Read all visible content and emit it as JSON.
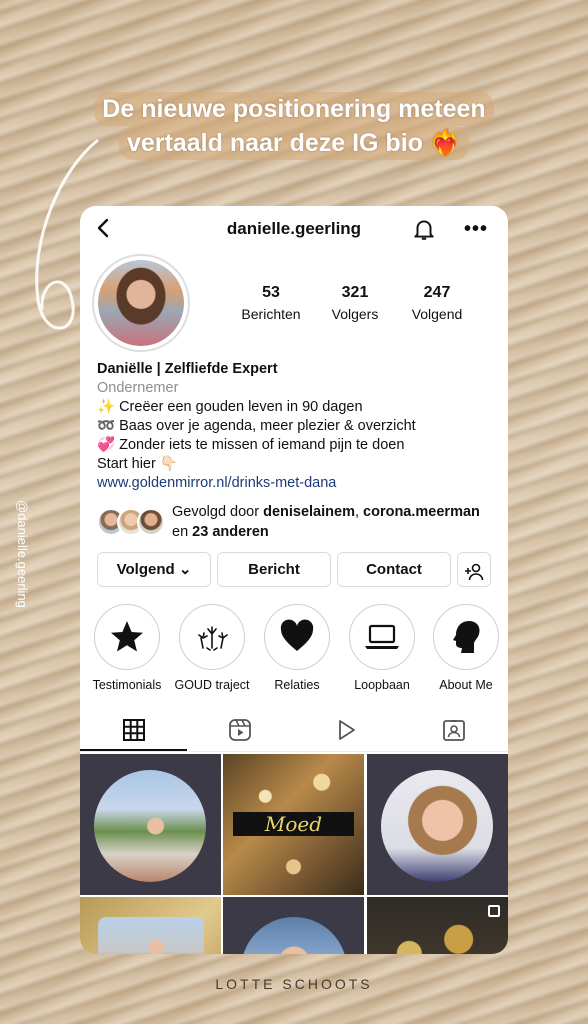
{
  "overlay": {
    "headline_line1": "De nieuwe positionering meteen",
    "headline_line2": "vertaald naar deze IG bio ❤️‍🔥",
    "side_handle": "@danielle.geerling",
    "footer": "LOTTE SCHOOTS"
  },
  "profile": {
    "username": "danielle.geerling",
    "stats": [
      {
        "value": "53",
        "label": "Berichten"
      },
      {
        "value": "321",
        "label": "Volgers"
      },
      {
        "value": "247",
        "label": "Volgend"
      }
    ],
    "name": "Daniëlle | Zelfliefde Expert",
    "category": "Ondernemer",
    "bio_lines": [
      "✨ Creëer een gouden leven in 90 dagen",
      "➿ Baas over je agenda, meer plezier & overzicht",
      "💞 Zonder iets te missen of iemand pijn te doen",
      "Start hier 👇🏻"
    ],
    "link": "www.goldenmirror.nl/drinks-met-dana",
    "followed_by_prefix": "Gevolgd door ",
    "followed_by_user1": "deniselainem",
    "followed_by_sep": ", ",
    "followed_by_user2": "corona.meerman",
    "followed_by_mid": "en ",
    "followed_by_others": "23 anderen"
  },
  "actions": {
    "following": "Volgend ⌄",
    "message": "Bericht",
    "contact": "Contact"
  },
  "highlights": [
    {
      "label": "Testimonials",
      "icon": "star-icon"
    },
    {
      "label": "GOUD traject",
      "icon": "fireworks-icon"
    },
    {
      "label": "Relaties",
      "icon": "heart-icon"
    },
    {
      "label": "Loopbaan",
      "icon": "laptop-icon"
    },
    {
      "label": "About Me",
      "icon": "head-silhouette-icon"
    }
  ],
  "grid": {
    "post2_text": "Moed"
  },
  "colors": {
    "link": "#1e3a7a",
    "category": "#8e8e8e",
    "sand": "#d9c4a7"
  }
}
